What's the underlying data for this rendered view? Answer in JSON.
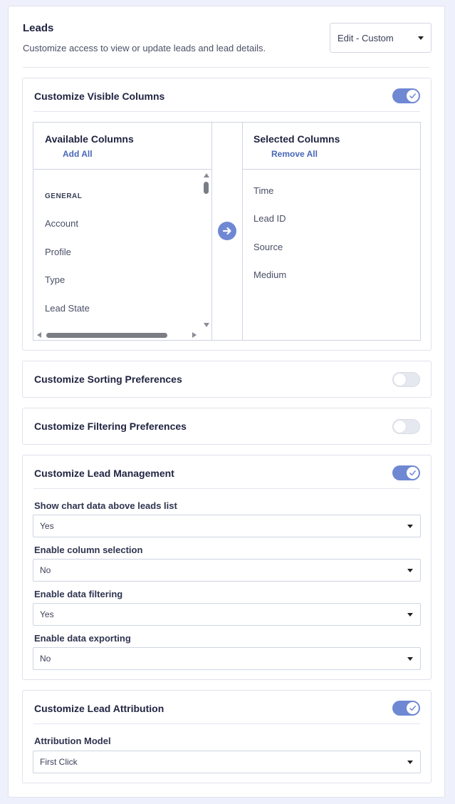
{
  "header": {
    "title": "Leads",
    "subtitle": "Customize access to view or update leads and lead details.",
    "access_select": "Edit - Custom"
  },
  "visible_columns": {
    "title": "Customize Visible Columns",
    "enabled": true,
    "available": {
      "title": "Available Columns",
      "action": "Add All",
      "group": "GENERAL",
      "items": [
        "Account",
        "Profile",
        "Type",
        "Lead State"
      ]
    },
    "selected": {
      "title": "Selected Columns",
      "action": "Remove All",
      "items": [
        "Time",
        "Lead ID",
        "Source",
        "Medium"
      ]
    }
  },
  "sorting": {
    "title": "Customize Sorting Preferences",
    "enabled": false
  },
  "filtering": {
    "title": "Customize Filtering Preferences",
    "enabled": false
  },
  "lead_management": {
    "title": "Customize Lead Management",
    "enabled": true,
    "fields": [
      {
        "label": "Show chart data above leads list",
        "value": "Yes"
      },
      {
        "label": "Enable column selection",
        "value": "No"
      },
      {
        "label": "Enable data filtering",
        "value": "Yes"
      },
      {
        "label": "Enable data exporting",
        "value": "No"
      }
    ]
  },
  "attribution": {
    "title": "Customize Lead Attribution",
    "enabled": true,
    "field": {
      "label": "Attribution Model",
      "value": "First Click"
    }
  },
  "colors": {
    "accent": "#6f88d3",
    "link": "#4867b8",
    "background": "#eef0fb"
  },
  "icons": {
    "toggle_on": "check-icon",
    "transfer": "arrow-right-circle-icon",
    "dropdown": "caret-down-icon"
  }
}
